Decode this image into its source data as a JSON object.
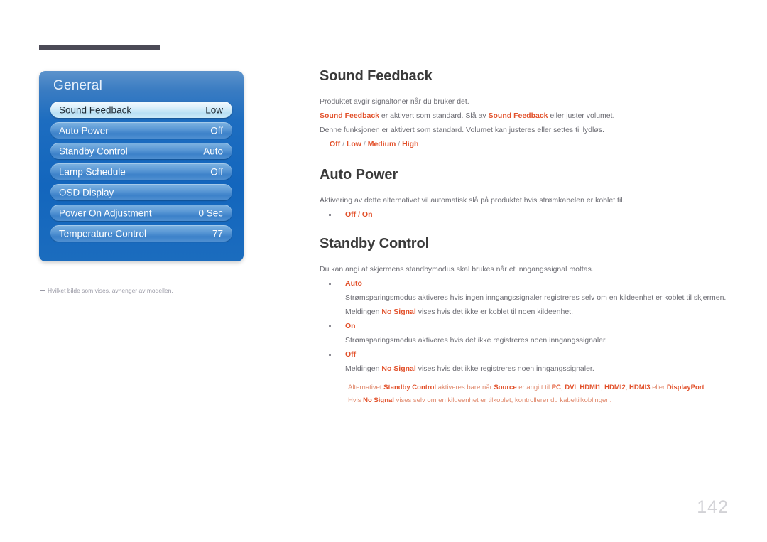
{
  "page": {
    "number": "142"
  },
  "osd": {
    "title": "General",
    "rows": [
      {
        "label": "Sound Feedback",
        "value": "Low",
        "selected": true
      },
      {
        "label": "Auto Power",
        "value": "Off",
        "selected": false
      },
      {
        "label": "Standby Control",
        "value": "Auto",
        "selected": false
      },
      {
        "label": "Lamp Schedule",
        "value": "Off",
        "selected": false
      },
      {
        "label": "OSD Display",
        "value": "",
        "selected": false
      },
      {
        "label": "Power On Adjustment",
        "value": "0 Sec",
        "selected": false
      },
      {
        "label": "Temperature Control",
        "value": "77",
        "selected": false
      }
    ],
    "footnote": "Hvilket bilde som vises, avhenger av modellen."
  },
  "sections": {
    "sound_feedback": {
      "title": "Sound Feedback",
      "p1": "Produktet avgir signaltoner når du bruker det.",
      "p2_a": "Sound Feedback",
      "p2_b": " er aktivert som standard. Slå av ",
      "p2_c": "Sound Feedback",
      "p2_d": " eller juster volumet.",
      "p3": "Denne funksjonen er aktivert som standard. Volumet kan justeres eller settes til lydløs.",
      "options": [
        "Off",
        "Low",
        "Medium",
        "High"
      ]
    },
    "auto_power": {
      "title": "Auto Power",
      "p1": "Aktivering av dette alternativet vil automatisk slå på produktet hvis strømkabelen er koblet til.",
      "bullet_head": "Off / On"
    },
    "standby_control": {
      "title": "Standby Control",
      "p1": "Du kan angi at skjermens standbymodus skal brukes når et inngangssignal mottas.",
      "bullets": [
        {
          "head": "Auto",
          "line1": "Strømsparingsmodus aktiveres hvis ingen inngangssignaler registreres selv om en kildeenhet er koblet til skjermen.",
          "line2_a": "Meldingen ",
          "line2_b": "No Signal",
          "line2_c": " vises hvis det ikke er koblet til noen kildeenhet."
        },
        {
          "head": "On",
          "line1": "Strømsparingsmodus aktiveres hvis det ikke registreres noen inngangssignaler.",
          "line2_a": "",
          "line2_b": "",
          "line2_c": ""
        },
        {
          "head": "Off",
          "line1": "",
          "line2_a": "Meldingen ",
          "line2_b": "No Signal",
          "line2_c": " vises hvis det ikke registreres noen inngangssignaler."
        }
      ],
      "notes": [
        {
          "t1": "Alternativet ",
          "b1": "Standby Control",
          "t2": " aktiveres bare når ",
          "b2": "Source",
          "t3": " er angitt til ",
          "b3": "PC",
          "t4": ", ",
          "b4": "DVI",
          "t5": ", ",
          "b5": "HDMI1",
          "t6": ", ",
          "b6": "HDMI2",
          "t7": ", ",
          "b7": "HDMI3",
          "t8": " eller ",
          "b8": "DisplayPort",
          "t9": "."
        },
        {
          "t1": "Hvis ",
          "b1": "No Signal",
          "t2": " vises selv om en kildeenhet er tilkoblet, kontrollerer du kabeltilkoblingen.",
          "b2": "",
          "t3": "",
          "b3": "",
          "t4": "",
          "b4": "",
          "t5": "",
          "b5": "",
          "t6": "",
          "b6": "",
          "t7": "",
          "b7": "",
          "t8": "",
          "b8": "",
          "t9": ""
        }
      ]
    }
  }
}
